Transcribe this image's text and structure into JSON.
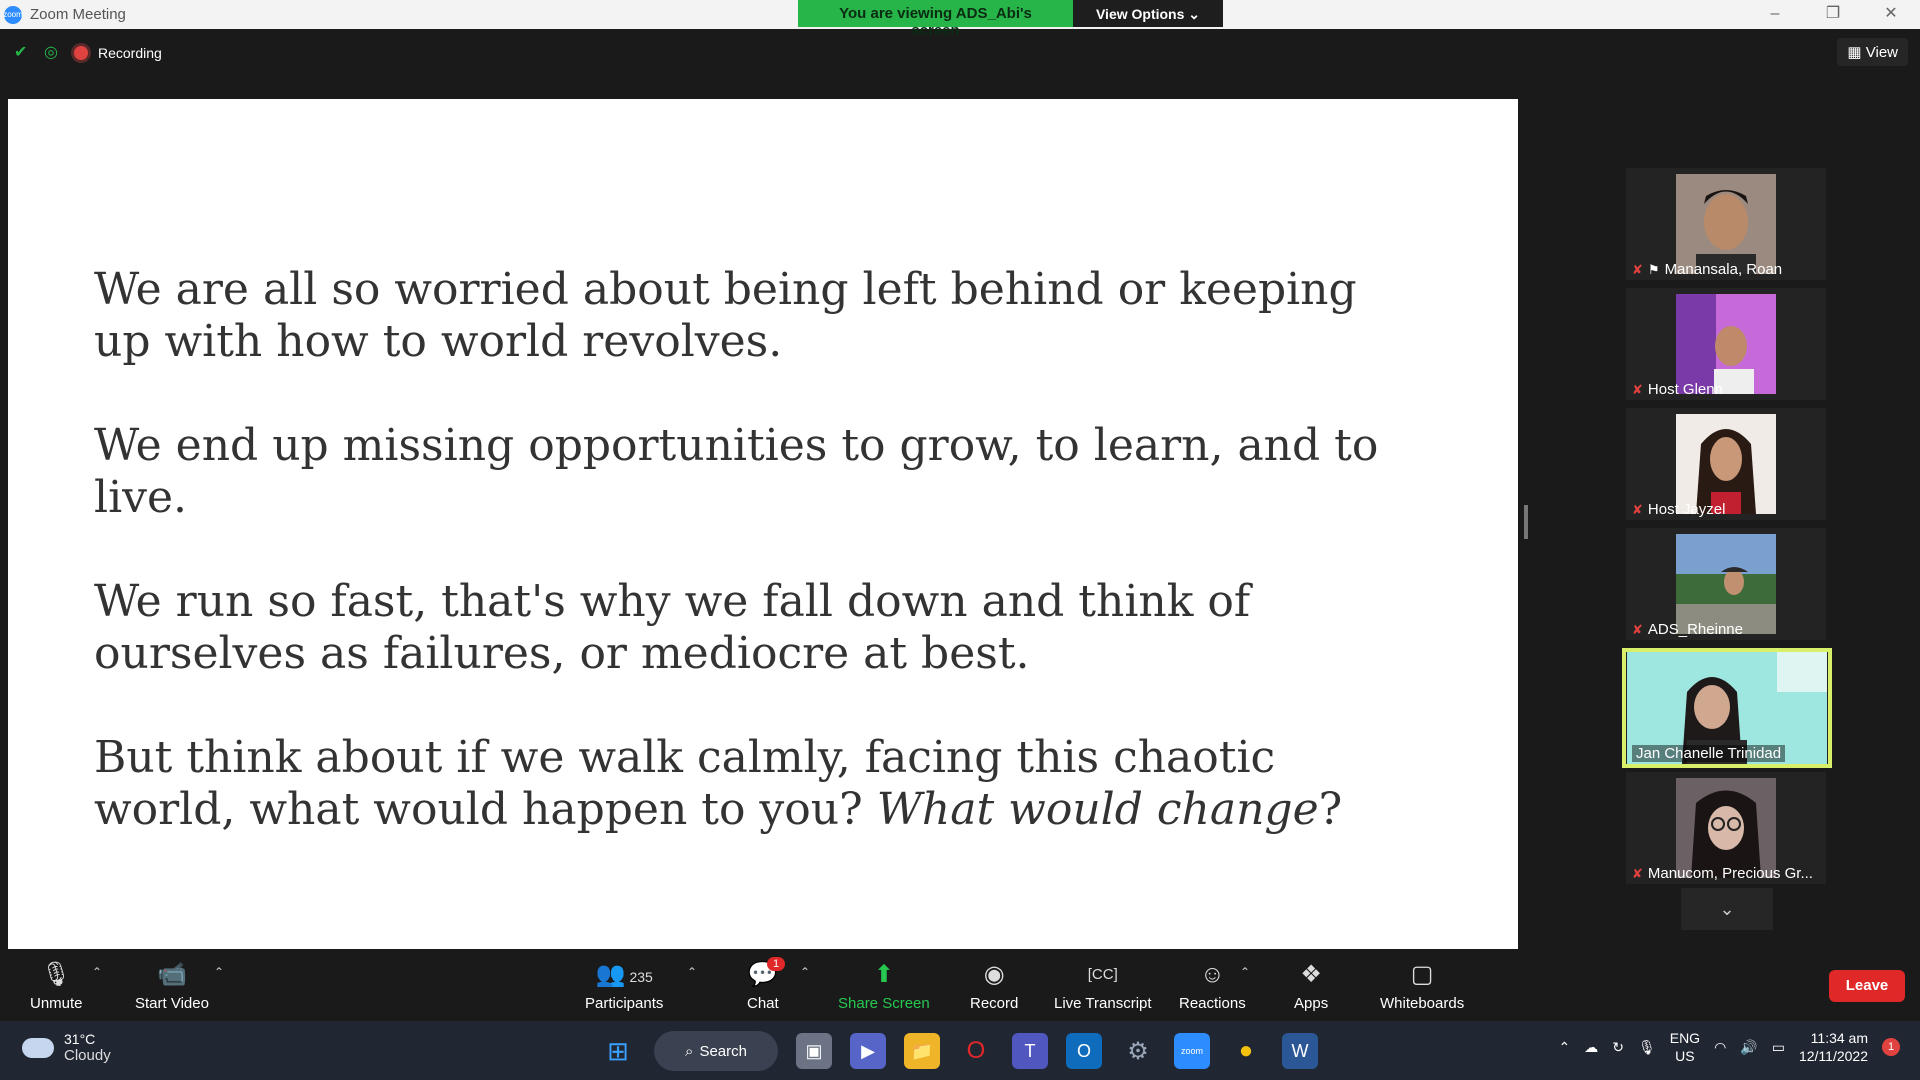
{
  "window": {
    "title": "Zoom Meeting",
    "banner_text": "You are viewing ADS_Abi's screen",
    "view_options_label": "View Options ⌄",
    "controls": [
      "–",
      "❐",
      "✕"
    ]
  },
  "status": {
    "recording_label": "Recording",
    "view_label": "View"
  },
  "slide": {
    "paragraph_1": "We are all so worried about being left behind or keeping up with how to world revolves.",
    "paragraph_2": "We end up missing opportunities to grow, to learn, and to live.",
    "paragraph_3": "We run so fast, that's why we fall down and think of ourselves as failures, or mediocre at best.",
    "paragraph_4_plain": "But think about if we walk calmly, facing this chaotic world, what would happen to you? ",
    "paragraph_4_italic": "What would change",
    "paragraph_4_end": "?"
  },
  "participants_gallery": [
    {
      "name": "Manansala, Roan",
      "muted": true,
      "pinned": true
    },
    {
      "name": "Host Glenn",
      "muted": true
    },
    {
      "name": "Host Jayzel",
      "muted": true
    },
    {
      "name": "ADS_Rheinne",
      "muted": true
    },
    {
      "name": "Jan Chanelle Trinidad",
      "muted": false,
      "active_speaker": true
    },
    {
      "name": "Manucom, Precious Gr...",
      "muted": true
    }
  ],
  "toolbar": {
    "unmute": "Unmute",
    "start_video": "Start Video",
    "participants": "Participants",
    "participants_count": "235",
    "chat": "Chat",
    "chat_badge": "1",
    "share_screen": "Share Screen",
    "record": "Record",
    "live_transcript": "Live Transcript",
    "reactions": "Reactions",
    "apps": "Apps",
    "whiteboards": "Whiteboards",
    "leave": "Leave"
  },
  "taskbar": {
    "weather_temp": "31°C",
    "weather_desc": "Cloudy",
    "search_label": "Search",
    "lang_1": "ENG",
    "lang_2": "US",
    "time": "11:34 am",
    "date": "12/11/2022",
    "notification_count": "1"
  },
  "colors": {
    "accent_green": "#27b54a",
    "leave_red": "#e02828",
    "active_speaker_border": "#d8ef6a"
  }
}
